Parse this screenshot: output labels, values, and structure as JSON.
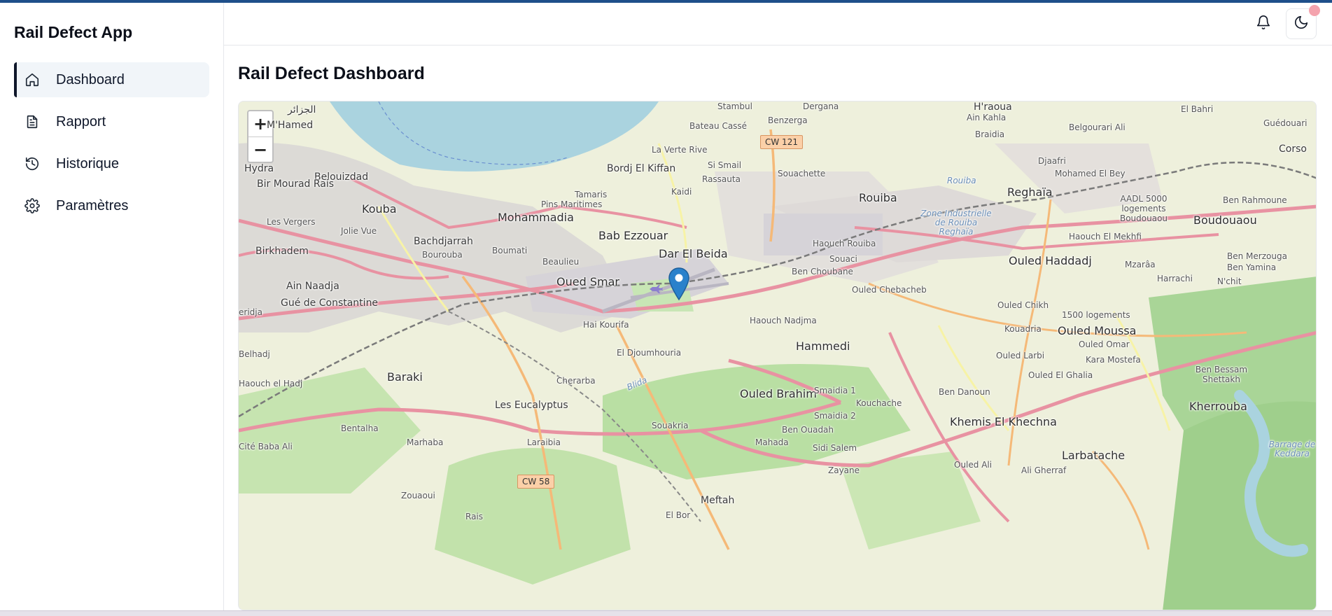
{
  "app": {
    "title": "Rail Defect App"
  },
  "sidebar": {
    "items": [
      {
        "label": "Dashboard",
        "icon": "home-icon",
        "active": true
      },
      {
        "label": "Rapport",
        "icon": "file-icon",
        "active": false
      },
      {
        "label": "Historique",
        "icon": "history-icon",
        "active": false
      },
      {
        "label": "Paramètres",
        "icon": "gear-icon",
        "active": false
      }
    ]
  },
  "header": {
    "notifications_icon": "bell-icon",
    "theme_icon": "moon-icon"
  },
  "page": {
    "title": "Rail Defect Dashboard"
  },
  "map": {
    "zoom_in": "+",
    "zoom_out": "−",
    "places": {
      "p1": "الجزائر",
      "p2": "M'Hamed",
      "p3": "Hydra",
      "p4": "Belouizdad",
      "p5": "Bir Mourad Rais",
      "p6": "Kouba",
      "p7": "Les Vergers",
      "p8": "Jolie Vue",
      "p9": "Birkhadem",
      "p10": "Bachdjarrah",
      "p11": "Bourouba",
      "p12": "Mohammadia",
      "p13": "Pins Maritimes",
      "p14": "Tamaris",
      "p15": "Bordj El Kiffan",
      "p16": "Bateau Cassé",
      "p17": "La Verte Rive",
      "p18": "Stambul",
      "p19": "Si Smail",
      "p20": "Rassauta",
      "p21": "Kaidi",
      "p22": "Bab Ezzouar",
      "p23": "Dar El Beida",
      "p24": "Oued Smar",
      "p25": "Beaulieu",
      "p26": "Boumati",
      "p27": "Ain Naadja",
      "p28": "Gué de Constantine",
      "p29": "Hai Kourifa",
      "p30": "El Djoumhouria",
      "p31": "Baraki",
      "p32": "Cherarba",
      "p33": "Les Eucalyptus",
      "p34": "Bentalha",
      "p35": "Marhaba",
      "p36": "Cité Baba Ali",
      "p37": "Laraibia",
      "p38": "Souakria",
      "p39": "Mahada",
      "p40": "Meftah",
      "p41": "Zouaoui",
      "p42": "Rais",
      "p43": "El Bor",
      "p44": "Belhadj",
      "p45": "Haouch el Hadj",
      "p46": "Benzerga",
      "p47": "Dergana",
      "p48": "Souachette",
      "p49": "Rouiba",
      "p50": "Haouch Rouiba",
      "p51": "Souaci",
      "p52": "Ben Choubane",
      "p53": "Ouled Chebacheb",
      "p54": "Haouch Nadjma",
      "p55": "Hammedi",
      "p56": "Ouled Brahim",
      "p57": "Smaidia 1",
      "p58": "Smaidia 2",
      "p59": "Kouchache",
      "p60": "Ben Ouadah",
      "p61": "Sidi Salem",
      "p62": "Zayane",
      "p63": "Ain Kahla",
      "p64": "Braidia",
      "p65": "H'raoua",
      "p66": "Reghaïa",
      "p67": "Zone Industrielle de Rouiba Reghaïa",
      "p68": "Rouiba",
      "p69": "Ouled Haddadj",
      "p70": "Ouled Chikh",
      "p71": "Kouadria",
      "p72": "Ouled Larbi",
      "p73": "Ouled El Ghalia",
      "p74": "Ben Danoun",
      "p75": "Khemis El Khechna",
      "p76": "Ouled Ali",
      "p77": "Ali Gherraf",
      "p78": "Larbatache",
      "p79": "Ouled Moussa",
      "p80": "Ouled Omar",
      "p81": "1500 logements",
      "p82": "Kara Mostefa",
      "p83": "Kherrouba",
      "p84": "Ben Rahmoune",
      "p85": "Boudouaou",
      "p86": "Haouch El Mekhfi",
      "p87": "Mzarâa",
      "p88": "Harrachi",
      "p89": "N'chit",
      "p90": "Ben Merzouga",
      "p91": "Ben Yamina",
      "p92": "Djaafri",
      "p93": "Mohamed El Bey",
      "p94": "AADL 5000 logements Boudouaou",
      "p95": "Belgourari Ali",
      "p96": "El Bahri",
      "p97": "Guédouari",
      "p98": "Corso",
      "p99": "Barrage de Keddara",
      "p100": "Blida",
      "p101": "Ben Bessam Shettakh",
      "p102": "eridja"
    },
    "badges": {
      "b1": "CW 121",
      "b2": "CW 58"
    }
  }
}
